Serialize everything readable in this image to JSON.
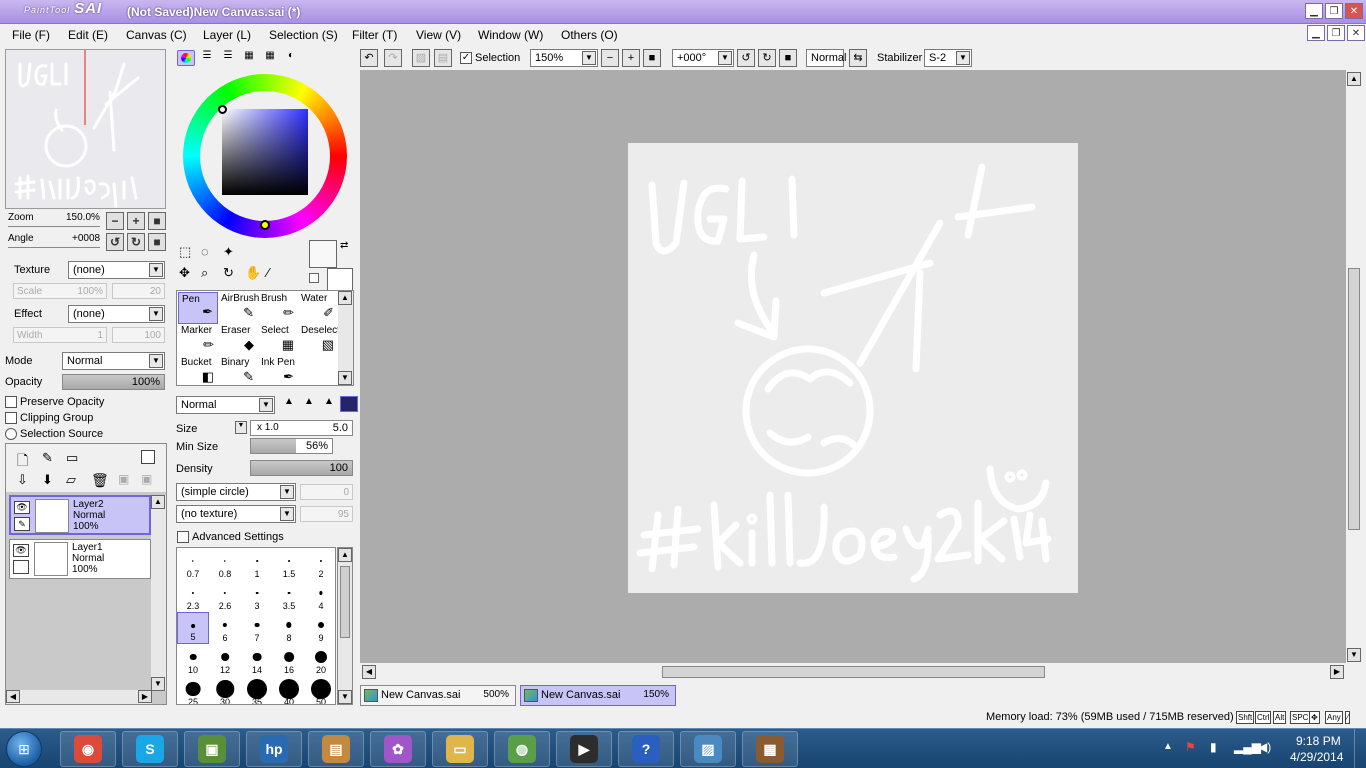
{
  "window": {
    "app_logo_small": "PaintTool",
    "app_logo": "SAI",
    "title": "(Not Saved)New Canvas.sai (*)"
  },
  "menu": [
    {
      "label": "File (F)"
    },
    {
      "label": "Edit (E)"
    },
    {
      "label": "Canvas (C)"
    },
    {
      "label": "Layer (L)"
    },
    {
      "label": "Selection (S)"
    },
    {
      "label": "Filter (T)"
    },
    {
      "label": "View (V)"
    },
    {
      "label": "Window (W)"
    },
    {
      "label": "Others (O)"
    }
  ],
  "navigator": {
    "zoom_label": "Zoom",
    "zoom_value": "150.0%",
    "angle_label": "Angle",
    "angle_value": "+0008"
  },
  "texture": {
    "label": "Texture",
    "value": "(none)",
    "scale_label": "Scale",
    "scale_value": "100%",
    "scale_num": "20"
  },
  "effect": {
    "label": "Effect",
    "value": "(none)",
    "width_label": "Width",
    "width_value": "1",
    "width_num": "100"
  },
  "layer_props": {
    "mode_label": "Mode",
    "mode_value": "Normal",
    "opacity_label": "Opacity",
    "opacity_value": "100%",
    "preserve_opacity": "Preserve Opacity",
    "clipping_group": "Clipping Group",
    "selection_source": "Selection Source"
  },
  "layers": [
    {
      "name": "Layer2",
      "mode": "Normal",
      "opacity": "100%",
      "active": true
    },
    {
      "name": "Layer1",
      "mode": "Normal",
      "opacity": "100%",
      "active": false
    }
  ],
  "tools": [
    {
      "label": "Pen",
      "icon": "pen-icon",
      "glyph": "✒",
      "active": true
    },
    {
      "label": "AirBrush",
      "icon": "airbrush-icon",
      "glyph": "✎"
    },
    {
      "label": "Brush",
      "icon": "brush-icon",
      "glyph": "🖌"
    },
    {
      "label": "Water",
      "icon": "water-icon",
      "glyph": "✐"
    },
    {
      "label": "Marker",
      "icon": "marker-icon",
      "glyph": "✏"
    },
    {
      "label": "Eraser",
      "icon": "eraser-icon",
      "glyph": "◆"
    },
    {
      "label": "Select",
      "icon": "select-icon",
      "glyph": "▦"
    },
    {
      "label": "Deselect",
      "icon": "deselect-icon",
      "glyph": "▧"
    },
    {
      "label": "Bucket",
      "icon": "bucket-icon",
      "glyph": "◧"
    },
    {
      "label": "Binary",
      "icon": "binary-icon",
      "glyph": "✎"
    },
    {
      "label": "Ink Pen",
      "icon": "ink-pen-icon",
      "glyph": "✒"
    }
  ],
  "brush": {
    "blend_mode": "Normal",
    "size_label": "Size",
    "size_mult": "x 1.0",
    "size_value": "5.0",
    "min_size_label": "Min Size",
    "min_size_value": "56%",
    "min_size_fill": 0.56,
    "density_label": "Density",
    "density_value": "100",
    "shape": "(simple circle)",
    "shape_value": "0",
    "texture": "(no texture)",
    "texture_value": "95",
    "advanced": "Advanced Settings"
  },
  "brush_sizes": [
    [
      "0.7",
      "0.8",
      "1",
      "1.5",
      "2"
    ],
    [
      "2.3",
      "2.6",
      "3",
      "3.5",
      "4"
    ],
    [
      "5",
      "6",
      "7",
      "8",
      "9"
    ],
    [
      "10",
      "12",
      "14",
      "16",
      "20"
    ],
    [
      "25",
      "30",
      "35",
      "40",
      "50"
    ]
  ],
  "active_brush_size": "5",
  "canvas_toolbar": {
    "selection_label": "Selection",
    "zoom_value": "150%",
    "angle_value": "+000°",
    "mode_value": "Normal",
    "stabilizer_label": "Stabilizer",
    "stabilizer_value": "S-2"
  },
  "drawing": {
    "top_text": "UGLI",
    "bottom_text": "#killJoey2k14",
    "stroke_color": "#ffffff",
    "paper_color": "#ececec"
  },
  "doc_tabs": [
    {
      "name": "New Canvas.sai",
      "zoom": "500%",
      "active": false
    },
    {
      "name": "New Canvas.sai",
      "zoom": "150%",
      "active": true
    }
  ],
  "status": {
    "memory": "Memory load: 73% (59MB used / 715MB reserved)",
    "keys": [
      "Shft",
      "Ctrl",
      "Alt",
      "SPC",
      "✥",
      "Any",
      "⁄"
    ]
  },
  "taskbar": {
    "apps": [
      {
        "icon": "chrome-icon",
        "glyph": "◉",
        "color": "#dd4a3a"
      },
      {
        "icon": "skype-icon",
        "glyph": "S",
        "color": "#1aa7e8"
      },
      {
        "icon": "minecraft-icon",
        "glyph": "▣",
        "color": "#5a8f3a"
      },
      {
        "icon": "hp-icon",
        "glyph": "hp",
        "color": "#2a6ab0"
      },
      {
        "icon": "wallet-icon",
        "glyph": "▤",
        "color": "#c28a40"
      },
      {
        "icon": "paint-palette-icon",
        "glyph": "✿",
        "color": "#a055c8"
      },
      {
        "icon": "folder-icon",
        "glyph": "▭",
        "color": "#e0b64a"
      },
      {
        "icon": "globe-icon",
        "glyph": "◍",
        "color": "#5a9f48"
      },
      {
        "icon": "media-player-icon",
        "glyph": "▶",
        "color": "#2d2d2d"
      },
      {
        "icon": "help-icon",
        "glyph": "?",
        "color": "#2a5fc0"
      },
      {
        "icon": "photo-viewer-icon",
        "glyph": "▨",
        "color": "#4a8ac0"
      },
      {
        "icon": "crafting-table-icon",
        "glyph": "▦",
        "color": "#8a5a30"
      }
    ],
    "time": "9:18 PM",
    "date": "4/29/2014"
  }
}
